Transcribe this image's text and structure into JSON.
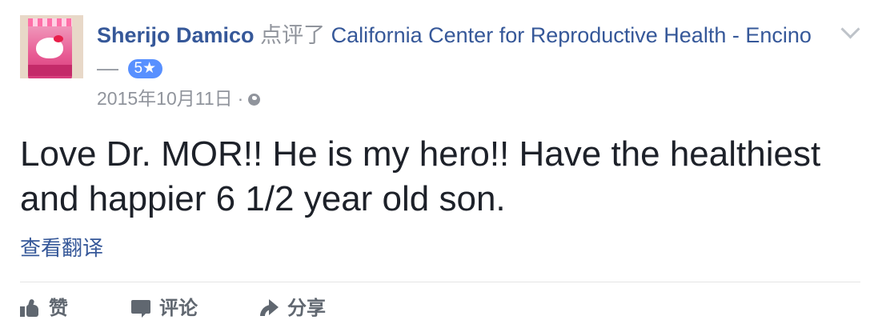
{
  "post": {
    "author": "Sherijo Damico",
    "verb": "点评了",
    "page": "California Center for Reproductive Health - Encino",
    "dash": "—",
    "rating": "5★",
    "timestamp": "2015年10月11日",
    "separator": "·",
    "privacy_icon": "globe-icon",
    "menu_icon": "chevron-down-icon",
    "text": "Love Dr. MOR!! He is my hero!! Have the healthiest and happier 6 1/2 year old son.",
    "translate_label": "查看翻译"
  },
  "actions": {
    "like": {
      "label": "赞",
      "icon": "thumbs-up-icon"
    },
    "comment": {
      "label": "评论",
      "icon": "comment-icon"
    },
    "share": {
      "label": "分享",
      "icon": "share-icon"
    }
  },
  "colors": {
    "link": "#365899",
    "meta": "#90949c",
    "badge": "#5890ff",
    "body_text": "#1d2129",
    "action_text": "#606770"
  }
}
